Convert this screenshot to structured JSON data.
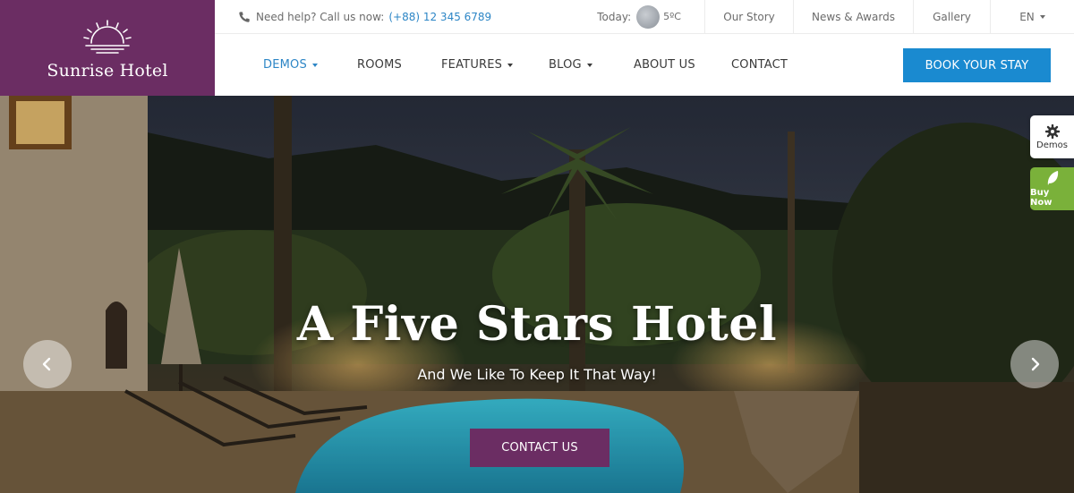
{
  "brand": {
    "name": "Sunrise Hotel",
    "color": "#6b2d63"
  },
  "topbar": {
    "help_label": "Need help? Call us now:",
    "phone": "(+88) 12 345 6789",
    "weather_label": "Today:",
    "weather_temp": "5ºC",
    "links": [
      {
        "label": "Our Story"
      },
      {
        "label": "News & Awards"
      },
      {
        "label": "Gallery"
      }
    ],
    "language": "EN"
  },
  "nav": {
    "items": [
      {
        "label": "DEMOS",
        "active": true,
        "dropdown": true
      },
      {
        "label": "ROOMS",
        "active": false,
        "dropdown": false
      },
      {
        "label": "FEATURES",
        "active": false,
        "dropdown": true
      },
      {
        "label": "BLOG",
        "active": false,
        "dropdown": true
      },
      {
        "label": "ABOUT US",
        "active": false,
        "dropdown": false
      },
      {
        "label": "CONTACT",
        "active": false,
        "dropdown": false
      }
    ],
    "cta": "BOOK YOUR STAY",
    "accent_color": "#2d86c6",
    "cta_color": "#1a8ad0"
  },
  "hero": {
    "title": "A Five Stars Hotel",
    "subtitle": "And We Like To Keep It That Way!",
    "button": "CONTACT US",
    "prev_icon": "chevron-left-icon",
    "next_icon": "chevron-right-icon"
  },
  "side": {
    "demos_label": "Demos",
    "buy_label": "Buy Now",
    "buy_color": "#7ab13a"
  }
}
